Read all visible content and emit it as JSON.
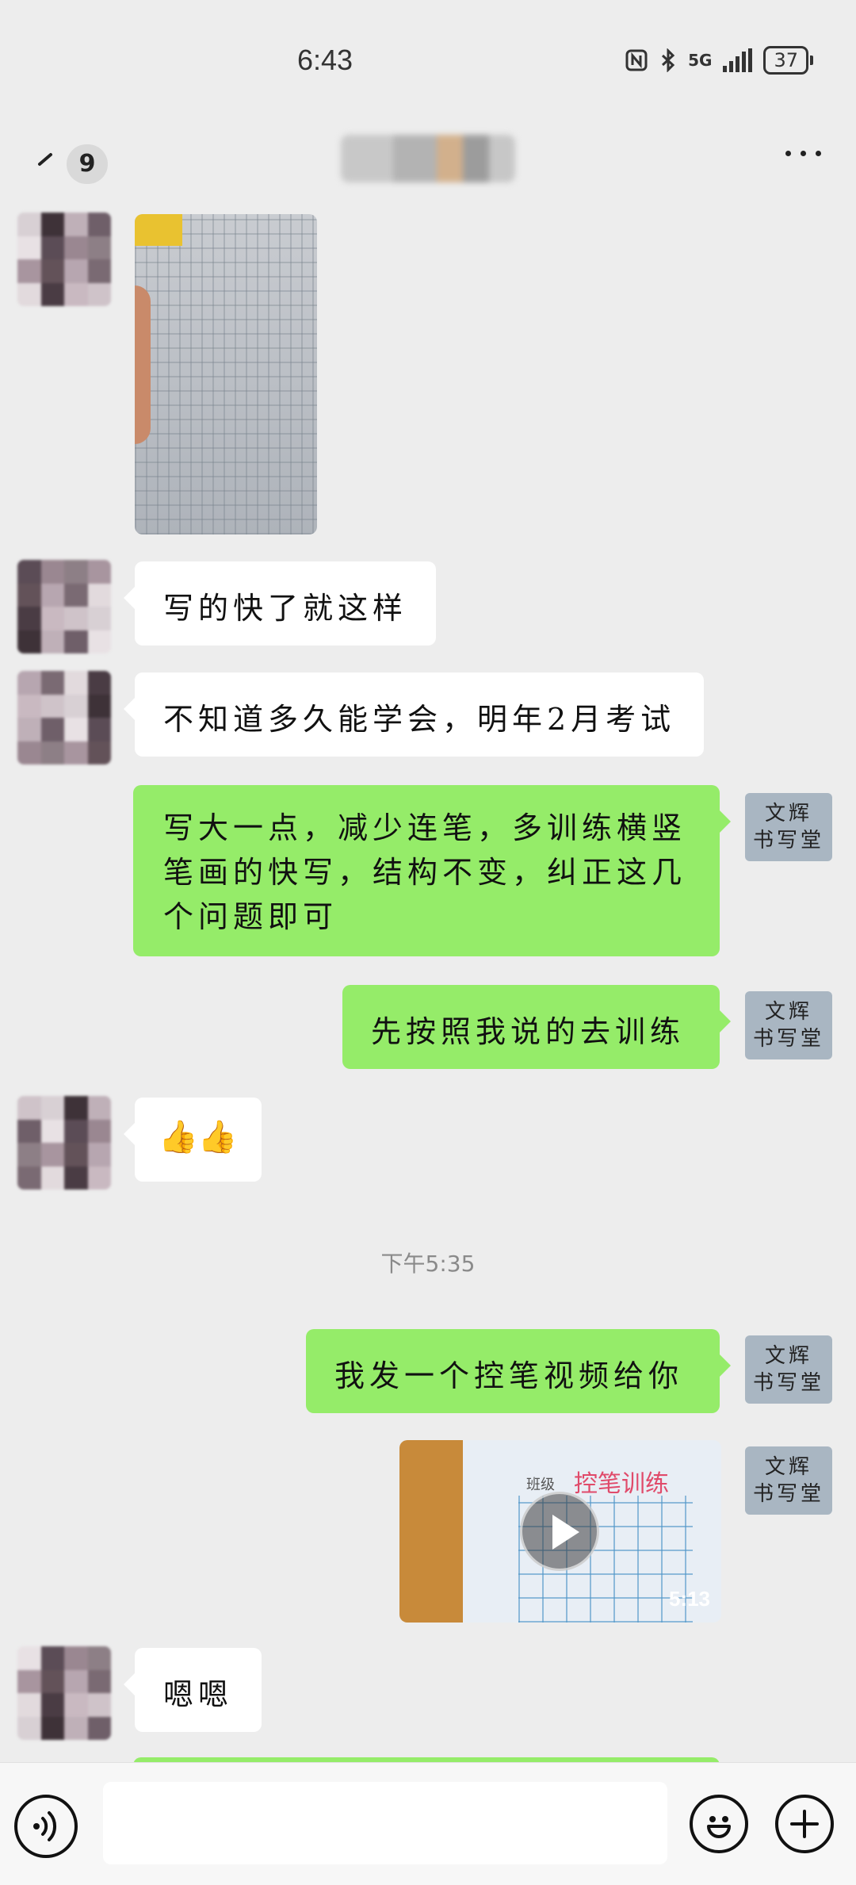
{
  "status_bar": {
    "time": "6:43",
    "network": "5G",
    "battery": "37"
  },
  "nav": {
    "unread_count": "9"
  },
  "messages": [
    {
      "sender": "contact",
      "type": "image"
    },
    {
      "sender": "contact",
      "type": "text",
      "text": "写的快了就这样"
    },
    {
      "sender": "contact",
      "type": "text",
      "text": "不知道多久能学会，明年2月考试"
    },
    {
      "sender": "self",
      "type": "text",
      "lines": [
        "写大一点，减少连笔，多训练横竖",
        "笔画的快写，结构不变，纠正这几",
        "个问题即可"
      ]
    },
    {
      "sender": "self",
      "type": "text",
      "text": "先按照我说的去训练"
    },
    {
      "sender": "contact",
      "type": "emoji",
      "text": "👍👍"
    },
    {
      "type": "timestamp",
      "text": "下午5:35"
    },
    {
      "sender": "self",
      "type": "text",
      "text": "我发一个控笔视频给你"
    },
    {
      "sender": "self",
      "type": "video",
      "duration": "5:13",
      "thumb_title": "控笔训练",
      "thumb_label": "班级"
    },
    {
      "sender": "contact",
      "type": "text",
      "text": "嗯嗯"
    }
  ],
  "self_avatar": {
    "line1": "文辉",
    "line2": "书写堂"
  },
  "input": {
    "placeholder": ""
  },
  "icons": {
    "back": "chevron-left-icon",
    "more": "more-dots-icon",
    "voice": "voice-icon",
    "emoji": "emoji-icon",
    "plus": "plus-icon"
  },
  "colors": {
    "background": "#ededed",
    "outgoing_bubble": "#95ec69",
    "incoming_bubble": "#ffffff"
  }
}
